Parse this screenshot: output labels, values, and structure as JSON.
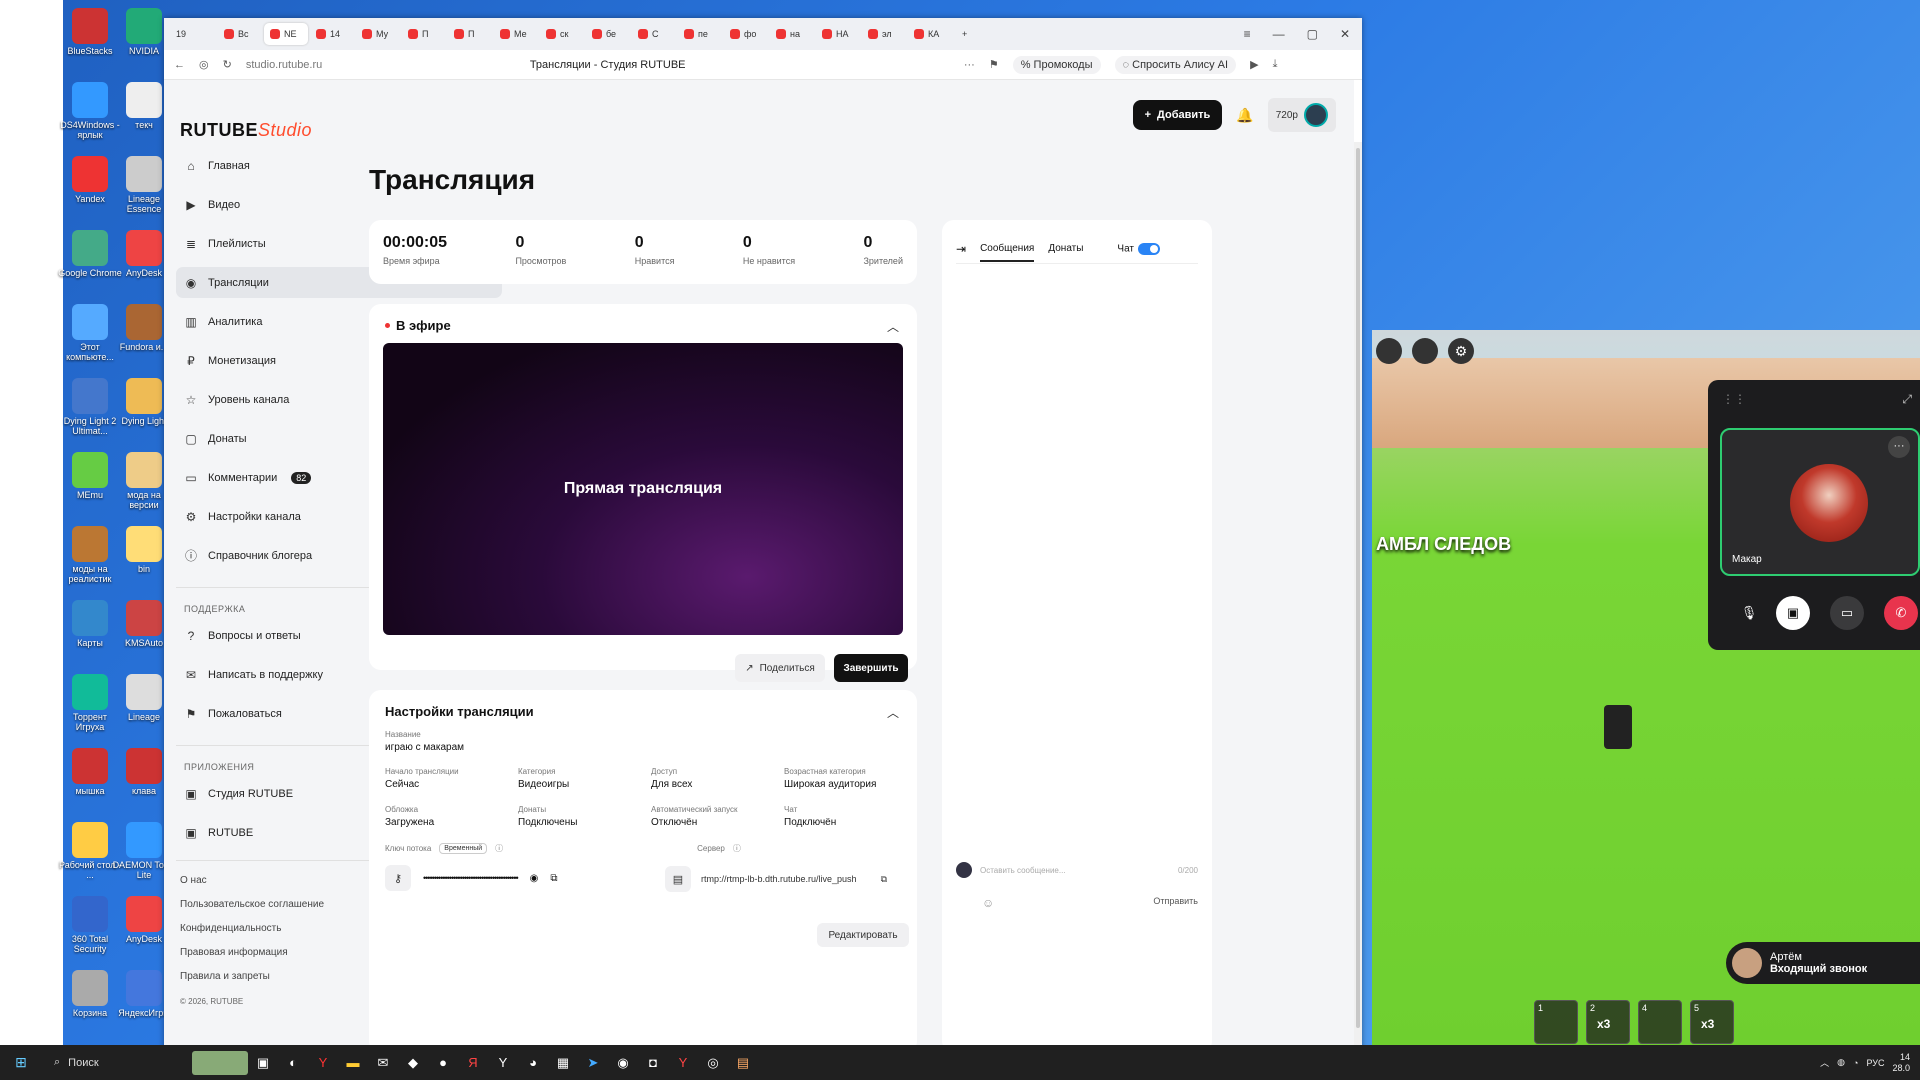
{
  "browser": {
    "tab_labels": [
      "Вс",
      "NE",
      "14",
      "Му",
      "П",
      "П",
      "Ме",
      "ск",
      "бе",
      "С",
      "пе",
      "фо",
      "на",
      "НА",
      "эл",
      "КА"
    ],
    "url": "studio.rutube.ru",
    "title": "Трансляции - Студия RUTUBE",
    "promo": "Промокоды",
    "alice": "Спросить Алису AI",
    "tab_count": "19"
  },
  "studio": {
    "logo_main": "RUTUBE",
    "logo_sub": "Studio",
    "add_button": "Добавить",
    "quality": "720p",
    "page_title": "Трансляция",
    "sidebar": {
      "items": [
        {
          "label": "Главная",
          "icon": "home-icon"
        },
        {
          "label": "Видео",
          "icon": "video-icon"
        },
        {
          "label": "Плейлисты",
          "icon": "playlist-icon"
        },
        {
          "label": "Трансляции",
          "icon": "broadcast-icon"
        },
        {
          "label": "Аналитика",
          "icon": "analytics-icon"
        },
        {
          "label": "Монетизация",
          "icon": "money-icon"
        },
        {
          "label": "Уровень канала",
          "icon": "star-icon"
        },
        {
          "label": "Донаты",
          "icon": "donate-icon"
        },
        {
          "label": "Комментарии",
          "icon": "comment-icon",
          "badge": "82"
        },
        {
          "label": "Настройки канала",
          "icon": "gear-icon"
        },
        {
          "label": "Справочник блогера",
          "icon": "info-icon"
        }
      ],
      "support_title": "ПОДДЕРЖКА",
      "support": [
        {
          "label": "Вопросы и ответы",
          "icon": "question-icon"
        },
        {
          "label": "Написать в поддержку",
          "icon": "mail-icon"
        },
        {
          "label": "Пожаловаться",
          "icon": "flag-icon"
        }
      ],
      "apps_title": "ПРИЛОЖЕНИЯ",
      "apps": [
        {
          "label": "Студия RUTUBE",
          "icon": "studio-app-icon"
        },
        {
          "label": "RUTUBE",
          "icon": "rutube-app-icon"
        }
      ],
      "footer_links": [
        "О нас",
        "Пользовательское соглашение",
        "Конфиденциальность",
        "Правовая информация",
        "Правила и запреты"
      ],
      "copyright": "© 2026, RUTUBE"
    },
    "stats": [
      {
        "value": "00:00:05",
        "label": "Время эфира"
      },
      {
        "value": "0",
        "label": "Просмотров"
      },
      {
        "value": "0",
        "label": "Нравится"
      },
      {
        "value": "0",
        "label": "Не нравится"
      },
      {
        "value": "0",
        "label": "Зрителей"
      }
    ],
    "live": {
      "header": "В эфире",
      "player_text": "Прямая трансляция",
      "share": "Поделиться",
      "end": "Завершить"
    },
    "settings": {
      "header": "Настройки трансляции",
      "name_label": "Название",
      "name_value": "играю с макарам",
      "start_label": "Начало трансляции",
      "start_value": "Сейчас",
      "category_label": "Категория",
      "category_value": "Видеоигры",
      "access_label": "Доступ",
      "access_value": "Для всех",
      "age_label": "Возрастная категория",
      "age_value": "Широкая аудитория",
      "cover_label": "Обложка",
      "cover_value": "Загружена",
      "donates_label": "Донаты",
      "donates_value": "Подключены",
      "autostart_label": "Автоматический запуск",
      "autostart_value": "Отключён",
      "chat_label": "Чат",
      "chat_value": "Подключён",
      "key_label": "Ключ потока",
      "key_tag": "Временный",
      "server_label": "Сервер",
      "key_value": "••••••••••••••••••••••••••••••••••••••••••••",
      "server_value": "rtmp://rtmp-lb-b.dth.rutube.ru/live_push",
      "edit": "Редактировать"
    },
    "chat": {
      "tab_messages": "Сообщения",
      "tab_donates": "Донаты",
      "tab_chat": "Чат",
      "input_placeholder": "Оставить сообщение...",
      "counter": "0/200",
      "send": "Отправить"
    }
  },
  "desktop_icons": [
    "BlueStacks",
    "NVIDIA",
    "DS4Windows - ярлык",
    "текч",
    "Yandex",
    "Lineage Essence",
    "Google Chrome",
    "AnyDesk",
    "Этот компьюте...",
    "Fundora и...",
    "Dying Light 2 Ultimat...",
    "Dying Light",
    "MEmu",
    "мода на версии",
    "моды на реалистик",
    "bin",
    "Карты",
    "KMSAuto",
    "Торрент Игруха",
    "Lineage",
    "мышка",
    "клава",
    "Рабочий стол - ...",
    "DAEMON Tools Lite",
    "360 Total Security",
    "AnyDesk",
    "Корзина",
    "ЯндексИгры"
  ],
  "game": {
    "board_text": "АМБЛ СЛЕДОВ",
    "hotbar": [
      {
        "n": "1",
        "x": ""
      },
      {
        "n": "2",
        "x": "x3"
      },
      {
        "n": "4",
        "x": ""
      },
      {
        "n": "5",
        "x": "x3"
      }
    ]
  },
  "call": {
    "name": "Макар",
    "caller": "Артём",
    "incoming": "Входящий звонок"
  },
  "taskbar": {
    "search": "Поиск",
    "lang": "РУС",
    "time": "14",
    "date": "28.0"
  }
}
